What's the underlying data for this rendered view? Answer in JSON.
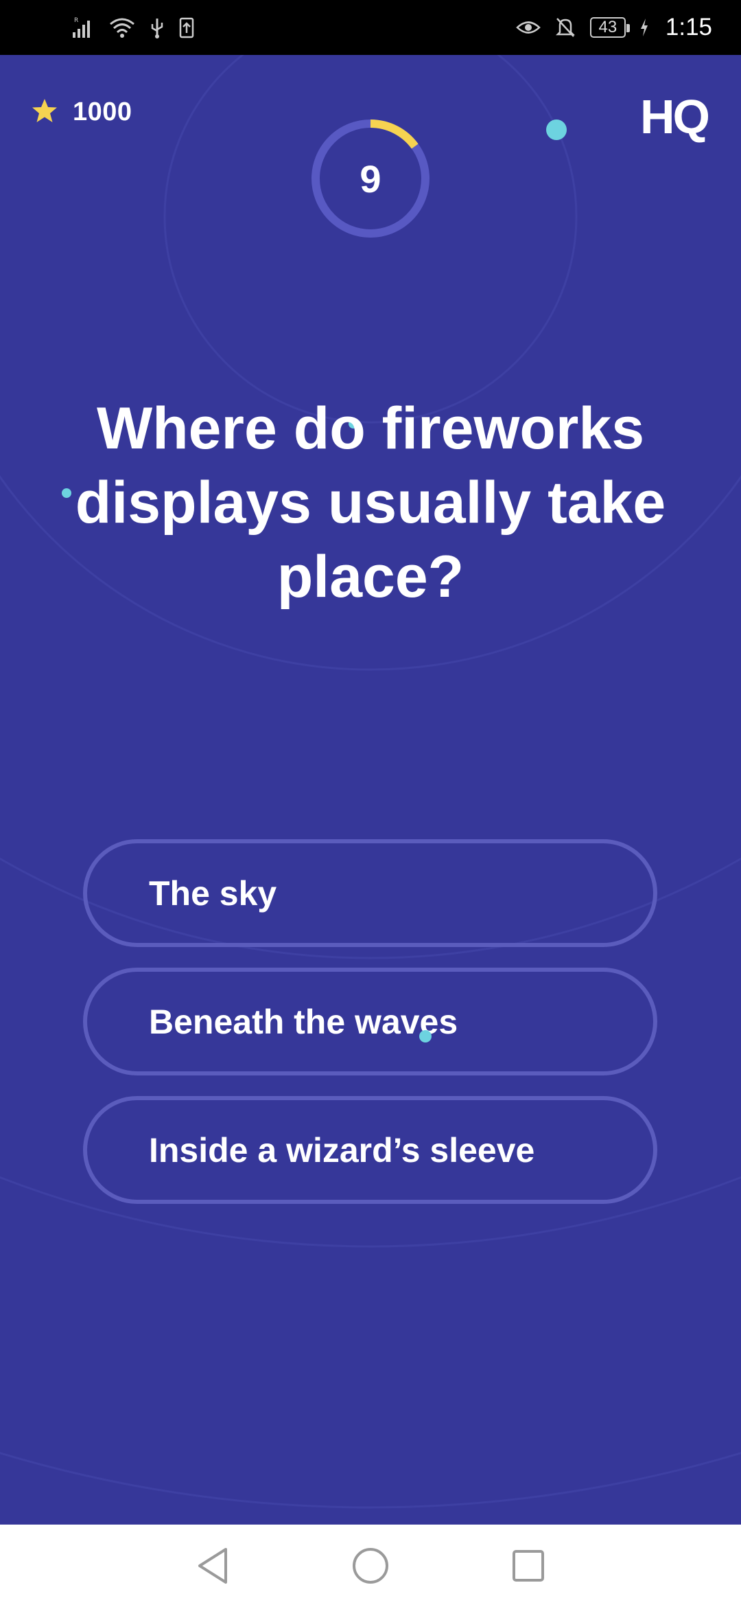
{
  "status_bar": {
    "time": "1:15",
    "battery_level": "43",
    "icons": [
      "signal-icon",
      "wifi-icon",
      "usb-icon",
      "upload-icon",
      "eye-icon",
      "bell-off-icon",
      "charging-icon"
    ]
  },
  "game": {
    "score": "1000",
    "logo": "HQ",
    "timer": "9",
    "timer_progress": 0.15,
    "question": "Where do fireworks displays usually take place?",
    "answers": [
      "The sky",
      "Beneath the waves",
      "Inside a wizard’s sleeve"
    ]
  },
  "colors": {
    "background": "#363799",
    "accent_yellow": "#f6d351",
    "ring": "#5b5cbd",
    "dot": "#6dd3e0"
  },
  "nav_bar": {
    "icons": [
      "back-icon",
      "home-icon",
      "recents-icon"
    ]
  }
}
